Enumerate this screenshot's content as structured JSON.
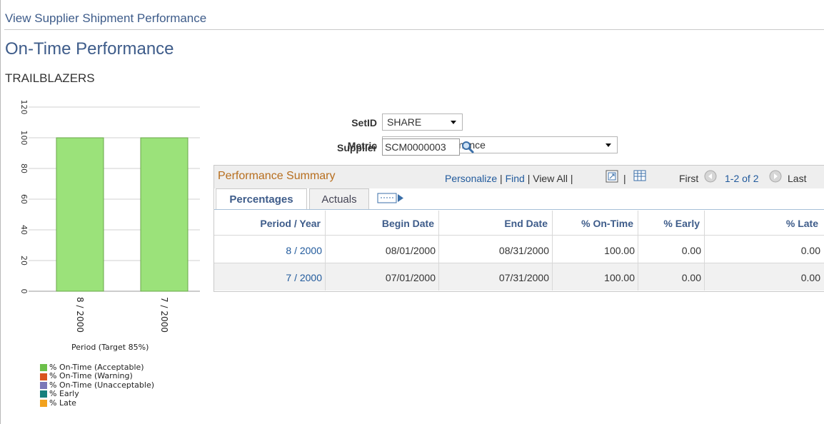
{
  "breadcrumb": "View Supplier Shipment Performance",
  "title": "On-Time Performance",
  "supplier_name": "TRAILBLAZERS",
  "form": {
    "setid_label": "SetID",
    "setid_value": "SHARE",
    "metric_label": "Metric",
    "metric_value": "On-Time Performance",
    "supplier_label": "Supplier",
    "supplier_value": "SCM0000003"
  },
  "grid": {
    "title": "Performance Summary",
    "personalize": "Personalize",
    "find": "Find",
    "view_all": "View All",
    "first": "First",
    "range": "1-2 of 2",
    "last": "Last",
    "tabs": [
      "Percentages",
      "Actuals"
    ],
    "columns": [
      "Period / Year",
      "Begin Date",
      "End Date",
      "% On-Time",
      "% Early",
      "% Late"
    ],
    "rows": [
      [
        "8 / 2000",
        "08/01/2000",
        "08/31/2000",
        "100.00",
        "0.00",
        "0.00"
      ],
      [
        "7 / 2000",
        "07/01/2000",
        "07/31/2000",
        "100.00",
        "0.00",
        "0.00"
      ]
    ]
  },
  "chart_data": {
    "type": "bar",
    "categories": [
      "8 / 2000",
      "7 / 2000"
    ],
    "series": [
      {
        "name": "% On-Time (Acceptable)",
        "values": [
          100,
          100
        ]
      }
    ],
    "xlabel": "Period (Target 85%)",
    "ylabel": "",
    "ylim": [
      0,
      120
    ],
    "yticks": [
      0,
      20,
      40,
      60,
      80,
      100,
      120
    ],
    "legend": [
      {
        "label": "% On-Time (Acceptable)",
        "color": "#6cc04a"
      },
      {
        "label": "% On-Time (Warning)",
        "color": "#d9541e"
      },
      {
        "label": "% On-Time (Unacceptable)",
        "color": "#7b77b8"
      },
      {
        "label": "% Early",
        "color": "#16807d"
      },
      {
        "label": "% Late",
        "color": "#f2a21e"
      }
    ],
    "bar_color": "#9be27a",
    "grid": true,
    "legend_position": "bottom"
  },
  "icons": {
    "lookup": "magnifier-icon",
    "prev": "prev-arrow-icon",
    "next": "next-arrow-icon",
    "zoom": "zoom-icon",
    "download": "download-grid-icon",
    "show_all_columns": "show-all-columns-icon"
  }
}
